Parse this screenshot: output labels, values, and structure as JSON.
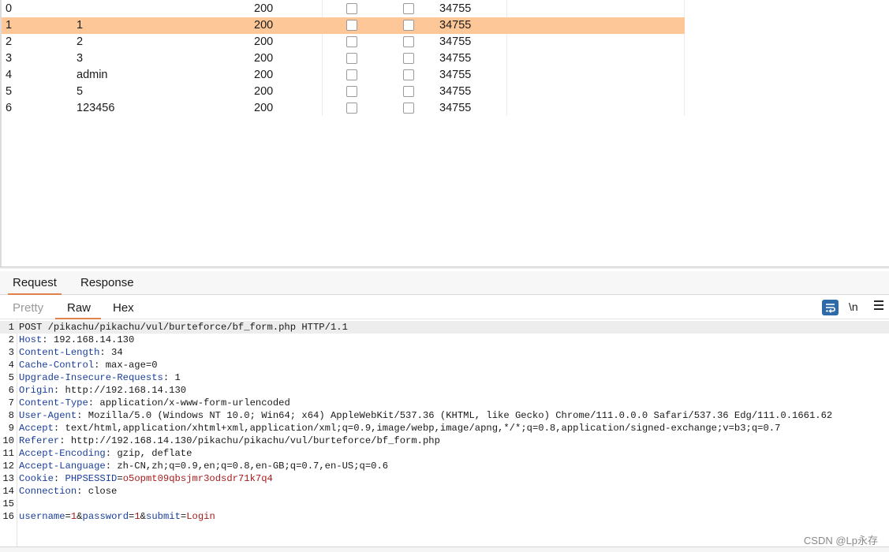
{
  "results": {
    "rows": [
      {
        "num": "0",
        "payload": "",
        "status": "200",
        "length": "34755",
        "selected": false
      },
      {
        "num": "1",
        "payload": "1",
        "status": "200",
        "length": "34755",
        "selected": true
      },
      {
        "num": "2",
        "payload": "2",
        "status": "200",
        "length": "34755",
        "selected": false
      },
      {
        "num": "3",
        "payload": "3",
        "status": "200",
        "length": "34755",
        "selected": false
      },
      {
        "num": "4",
        "payload": "admin",
        "status": "200",
        "length": "34755",
        "selected": false
      },
      {
        "num": "5",
        "payload": "5",
        "status": "200",
        "length": "34755",
        "selected": false
      },
      {
        "num": "6",
        "payload": "123456",
        "status": "200",
        "length": "34755",
        "selected": false
      }
    ]
  },
  "tabs": {
    "request": "Request",
    "response": "Response",
    "active": "Request"
  },
  "subtabs": {
    "pretty": "Pretty",
    "raw": "Raw",
    "hex": "Hex",
    "active": "Raw"
  },
  "toolbar": {
    "wrap_icon": "wrap-lines-icon",
    "newline_label": "\\n",
    "menu_icon": "hamburger-menu-icon",
    "accent_color": "#2e6aa8"
  },
  "request": {
    "lines": [
      {
        "n": "1",
        "type": "plain",
        "text": "POST /pikachu/pikachu/vul/burteforce/bf_form.php HTTP/1.1"
      },
      {
        "n": "2",
        "type": "header",
        "key": "Host",
        "value": " 192.168.14.130"
      },
      {
        "n": "3",
        "type": "header",
        "key": "Content-Length",
        "value": " 34"
      },
      {
        "n": "4",
        "type": "header",
        "key": "Cache-Control",
        "value": " max-age=0"
      },
      {
        "n": "5",
        "type": "header",
        "key": "Upgrade-Insecure-Requests",
        "value": " 1"
      },
      {
        "n": "6",
        "type": "header",
        "key": "Origin",
        "value": " http://192.168.14.130"
      },
      {
        "n": "7",
        "type": "header",
        "key": "Content-Type",
        "value": " application/x-www-form-urlencoded"
      },
      {
        "n": "8",
        "type": "header",
        "key": "User-Agent",
        "value": " Mozilla/5.0 (Windows NT 10.0; Win64; x64) AppleWebKit/537.36 (KHTML, like Gecko) Chrome/111.0.0.0 Safari/537.36 Edg/111.0.1661.62"
      },
      {
        "n": "9",
        "type": "header",
        "key": "Accept",
        "value": " text/html,application/xhtml+xml,application/xml;q=0.9,image/webp,image/apng,*/*;q=0.8,application/signed-exchange;v=b3;q=0.7"
      },
      {
        "n": "10",
        "type": "header",
        "key": "Referer",
        "value": " http://192.168.14.130/pikachu/pikachu/vul/burteforce/bf_form.php"
      },
      {
        "n": "11",
        "type": "header",
        "key": "Accept-Encoding",
        "value": " gzip, deflate"
      },
      {
        "n": "12",
        "type": "header",
        "key": "Accept-Language",
        "value": " zh-CN,zh;q=0.9,en;q=0.8,en-GB;q=0.7,en-US;q=0.6"
      },
      {
        "n": "13",
        "type": "cookie",
        "key": "Cookie",
        "cname": "PHPSESSID",
        "cvalue": "o5opmt09qbsjmr3odsdr71k7q4"
      },
      {
        "n": "14",
        "type": "header",
        "key": "Connection",
        "value": " close"
      },
      {
        "n": "15",
        "type": "blank"
      },
      {
        "n": "16",
        "type": "params",
        "params": [
          {
            "k": "username",
            "v": "1"
          },
          {
            "k": "password",
            "v": "1"
          },
          {
            "k": "submit",
            "v": "Login"
          }
        ]
      }
    ]
  },
  "watermark": "CSDN @Lp永存",
  "colors": {
    "selected_row": "#fdc797",
    "tab_underline": "#e0804a",
    "header_key": "#1a3e9c",
    "param_value": "#a61c1c"
  }
}
